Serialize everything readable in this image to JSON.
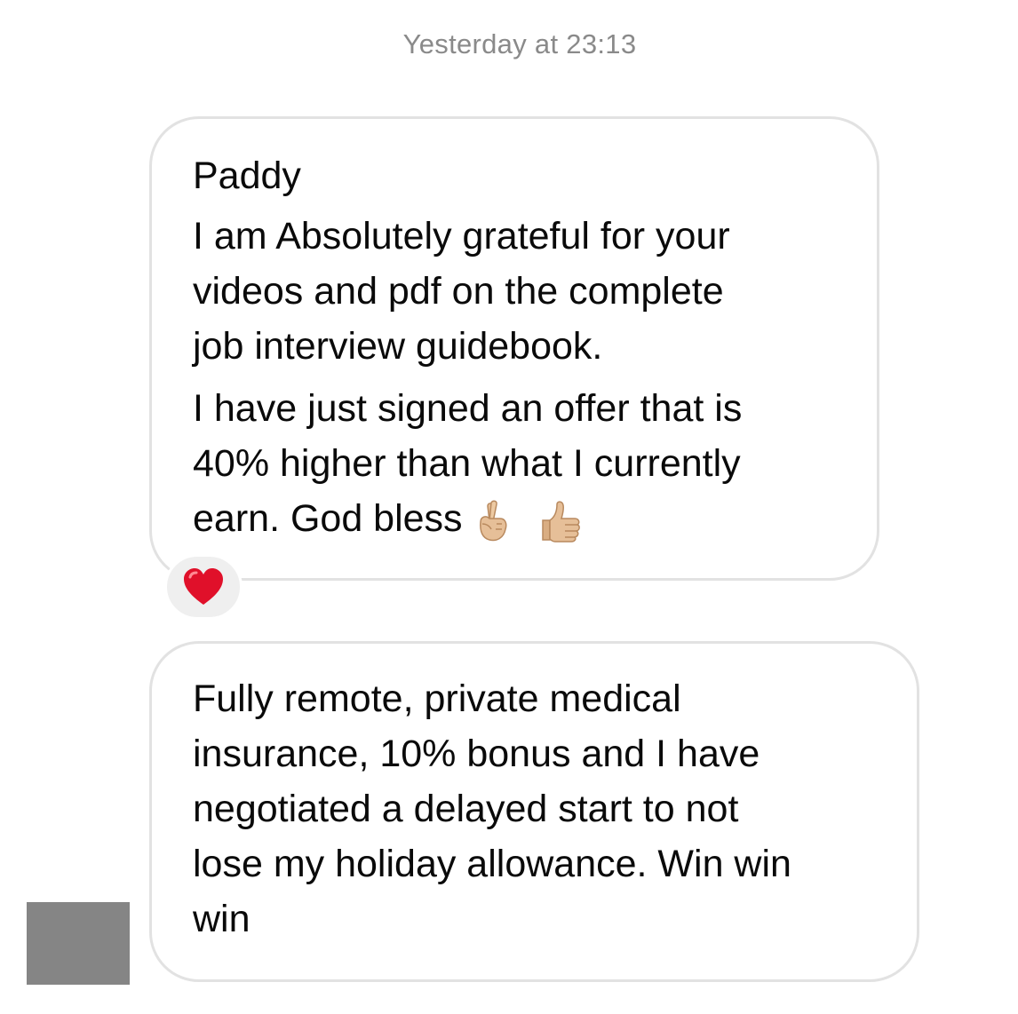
{
  "timestamp": "Yesterday at 23:13",
  "messages": [
    {
      "sender": "Paddy",
      "paragraphs": [
        [
          "I am Absolutely grateful for your",
          "videos and pdf on the complete",
          "job interview guidebook."
        ],
        [
          "I have just signed an offer that is",
          "40% higher than what I currently",
          "earn. God bless"
        ]
      ],
      "emojis": [
        "crossed-fingers-icon",
        "thumbs-up-icon"
      ],
      "reaction": "heart-icon"
    },
    {
      "paragraphs": [
        [
          "Fully remote, private medical",
          "insurance, 10% bonus and I have",
          "negotiated a delayed start to not",
          "lose my holiday allowance. Win win",
          "win"
        ]
      ]
    }
  ],
  "colors": {
    "bubble_border": "#e2e2e2",
    "timestamp_text": "#8a8a8a",
    "reaction_bg": "#efefef",
    "heart": "#e0102a",
    "avatar_placeholder": "#858585",
    "skin_tone": "#e6bf98"
  }
}
